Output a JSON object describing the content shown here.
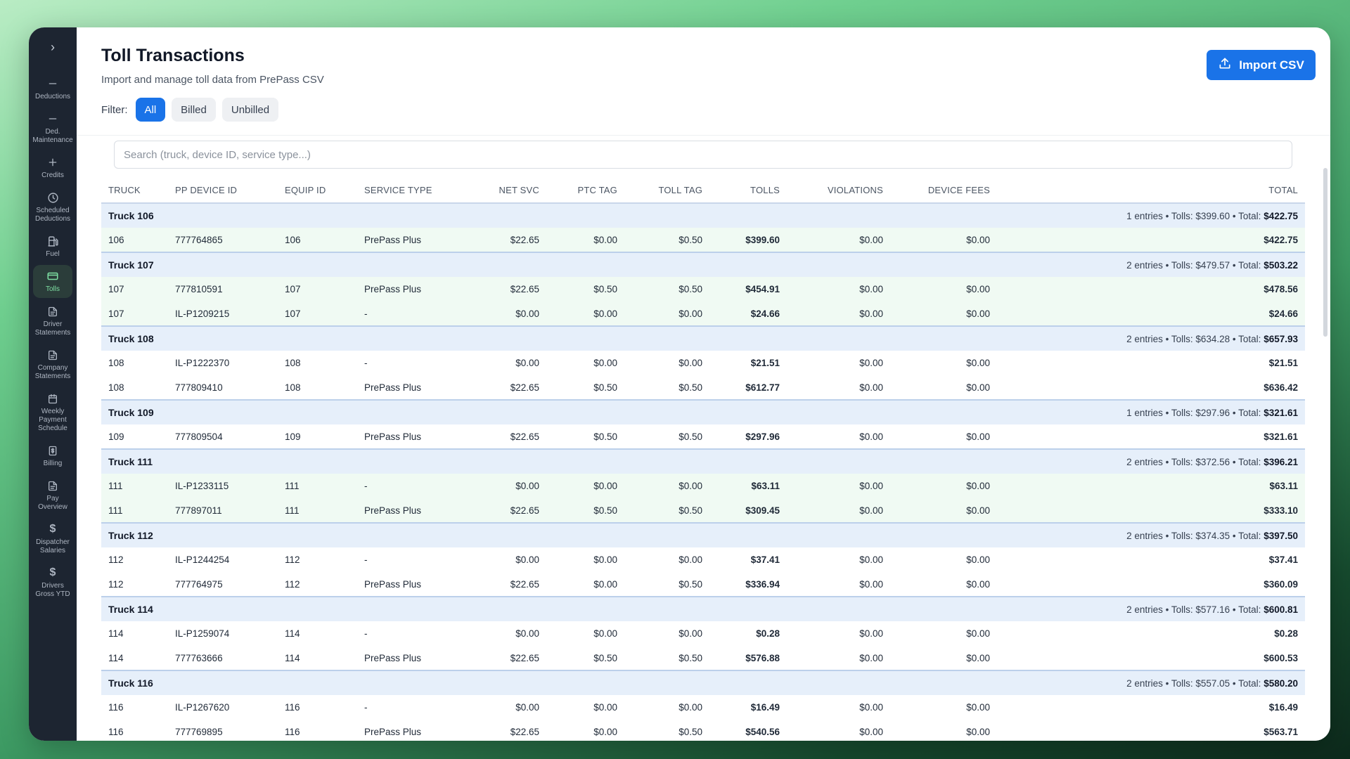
{
  "sidebar": {
    "toggle": "›",
    "items": [
      {
        "label": "Deductions",
        "icon": "minus-icon"
      },
      {
        "label": "Ded. Maintenance",
        "icon": "minus-icon"
      },
      {
        "label": "Credits",
        "icon": "plus-icon"
      },
      {
        "label": "Scheduled Deductions",
        "icon": "clock-icon"
      },
      {
        "label": "Fuel",
        "icon": "fuel-icon"
      },
      {
        "label": "Tolls",
        "icon": "card-icon",
        "active": true
      },
      {
        "label": "Driver Statements",
        "icon": "document-icon"
      },
      {
        "label": "Company Statements",
        "icon": "document-icon"
      },
      {
        "label": "Weekly Payment Schedule",
        "icon": "calendar-icon"
      },
      {
        "label": "Billing",
        "icon": "receipt-icon"
      },
      {
        "label": "Pay Overview",
        "icon": "document-icon"
      },
      {
        "label": "Dispatcher Salaries",
        "icon": "dollar-icon"
      },
      {
        "label": "Drivers Gross YTD",
        "icon": "dollar-icon"
      }
    ]
  },
  "header": {
    "title": "Toll Transactions",
    "subtitle": "Import and manage toll data from PrePass CSV",
    "import_label": "Import CSV",
    "filter_label": "Filter:",
    "filters": [
      "All",
      "Billed",
      "Unbilled"
    ],
    "active_filter": "All"
  },
  "search": {
    "placeholder": "Search (truck, device ID, service type...)"
  },
  "table": {
    "columns": [
      "TRUCK",
      "PP DEVICE ID",
      "EQUIP ID",
      "SERVICE TYPE",
      "NET SVC",
      "PTC TAG",
      "TOLL TAG",
      "TOLLS",
      "VIOLATIONS",
      "DEVICE FEES",
      "TOTAL"
    ],
    "groups": [
      {
        "name": "Truck 106",
        "entries": "1 entries • Tolls: $399.60 • Total: ",
        "total": "$422.75",
        "rows": [
          {
            "truck": "106",
            "device": "777764865",
            "equip": "106",
            "service": "PrePass Plus",
            "net": "$22.65",
            "ptc": "$0.00",
            "toll": "$0.50",
            "tolls": "$399.60",
            "viol": "$0.00",
            "fees": "$0.00",
            "total": "$422.75",
            "billed": true
          }
        ]
      },
      {
        "name": "Truck 107",
        "entries": "2 entries • Tolls: $479.57 • Total: ",
        "total": "$503.22",
        "rows": [
          {
            "truck": "107",
            "device": "777810591",
            "equip": "107",
            "service": "PrePass Plus",
            "net": "$22.65",
            "ptc": "$0.50",
            "toll": "$0.50",
            "tolls": "$454.91",
            "viol": "$0.00",
            "fees": "$0.00",
            "total": "$478.56",
            "billed": true
          },
          {
            "truck": "107",
            "device": "IL-P1209215",
            "equip": "107",
            "service": "-",
            "net": "$0.00",
            "ptc": "$0.00",
            "toll": "$0.00",
            "tolls": "$24.66",
            "viol": "$0.00",
            "fees": "$0.00",
            "total": "$24.66",
            "billed": true
          }
        ]
      },
      {
        "name": "Truck 108",
        "entries": "2 entries • Tolls: $634.28 • Total: ",
        "total": "$657.93",
        "rows": [
          {
            "truck": "108",
            "device": "IL-P1222370",
            "equip": "108",
            "service": "-",
            "net": "$0.00",
            "ptc": "$0.00",
            "toll": "$0.00",
            "tolls": "$21.51",
            "viol": "$0.00",
            "fees": "$0.00",
            "total": "$21.51",
            "billed": false
          },
          {
            "truck": "108",
            "device": "777809410",
            "equip": "108",
            "service": "PrePass Plus",
            "net": "$22.65",
            "ptc": "$0.50",
            "toll": "$0.50",
            "tolls": "$612.77",
            "viol": "$0.00",
            "fees": "$0.00",
            "total": "$636.42",
            "billed": false
          }
        ]
      },
      {
        "name": "Truck 109",
        "entries": "1 entries • Tolls: $297.96 • Total: ",
        "total": "$321.61",
        "rows": [
          {
            "truck": "109",
            "device": "777809504",
            "equip": "109",
            "service": "PrePass Plus",
            "net": "$22.65",
            "ptc": "$0.50",
            "toll": "$0.50",
            "tolls": "$297.96",
            "viol": "$0.00",
            "fees": "$0.00",
            "total": "$321.61",
            "billed": false
          }
        ]
      },
      {
        "name": "Truck 111",
        "entries": "2 entries • Tolls: $372.56 • Total: ",
        "total": "$396.21",
        "rows": [
          {
            "truck": "111",
            "device": "IL-P1233115",
            "equip": "111",
            "service": "-",
            "net": "$0.00",
            "ptc": "$0.00",
            "toll": "$0.00",
            "tolls": "$63.11",
            "viol": "$0.00",
            "fees": "$0.00",
            "total": "$63.11",
            "billed": true
          },
          {
            "truck": "111",
            "device": "777897011",
            "equip": "111",
            "service": "PrePass Plus",
            "net": "$22.65",
            "ptc": "$0.50",
            "toll": "$0.50",
            "tolls": "$309.45",
            "viol": "$0.00",
            "fees": "$0.00",
            "total": "$333.10",
            "billed": true
          }
        ]
      },
      {
        "name": "Truck 112",
        "entries": "2 entries • Tolls: $374.35 • Total: ",
        "total": "$397.50",
        "rows": [
          {
            "truck": "112",
            "device": "IL-P1244254",
            "equip": "112",
            "service": "-",
            "net": "$0.00",
            "ptc": "$0.00",
            "toll": "$0.00",
            "tolls": "$37.41",
            "viol": "$0.00",
            "fees": "$0.00",
            "total": "$37.41",
            "billed": false
          },
          {
            "truck": "112",
            "device": "777764975",
            "equip": "112",
            "service": "PrePass Plus",
            "net": "$22.65",
            "ptc": "$0.00",
            "toll": "$0.50",
            "tolls": "$336.94",
            "viol": "$0.00",
            "fees": "$0.00",
            "total": "$360.09",
            "billed": false
          }
        ]
      },
      {
        "name": "Truck 114",
        "entries": "2 entries • Tolls: $577.16 • Total: ",
        "total": "$600.81",
        "rows": [
          {
            "truck": "114",
            "device": "IL-P1259074",
            "equip": "114",
            "service": "-",
            "net": "$0.00",
            "ptc": "$0.00",
            "toll": "$0.00",
            "tolls": "$0.28",
            "viol": "$0.00",
            "fees": "$0.00",
            "total": "$0.28",
            "billed": false
          },
          {
            "truck": "114",
            "device": "777763666",
            "equip": "114",
            "service": "PrePass Plus",
            "net": "$22.65",
            "ptc": "$0.50",
            "toll": "$0.50",
            "tolls": "$576.88",
            "viol": "$0.00",
            "fees": "$0.00",
            "total": "$600.53",
            "billed": false
          }
        ]
      },
      {
        "name": "Truck 116",
        "entries": "2 entries • Tolls: $557.05 • Total: ",
        "total": "$580.20",
        "rows": [
          {
            "truck": "116",
            "device": "IL-P1267620",
            "equip": "116",
            "service": "-",
            "net": "$0.00",
            "ptc": "$0.00",
            "toll": "$0.00",
            "tolls": "$16.49",
            "viol": "$0.00",
            "fees": "$0.00",
            "total": "$16.49",
            "billed": false
          },
          {
            "truck": "116",
            "device": "777769895",
            "equip": "116",
            "service": "PrePass Plus",
            "net": "$22.65",
            "ptc": "$0.00",
            "toll": "$0.50",
            "tolls": "$540.56",
            "viol": "$0.00",
            "fees": "$0.00",
            "total": "$563.71",
            "billed": false
          }
        ]
      }
    ]
  },
  "colors": {
    "accent": "#1a73e8",
    "sidebar": "#1d2531",
    "violation": "#e02424",
    "group_bg": "#e6effa",
    "billed_bg": "#f0faf3"
  }
}
